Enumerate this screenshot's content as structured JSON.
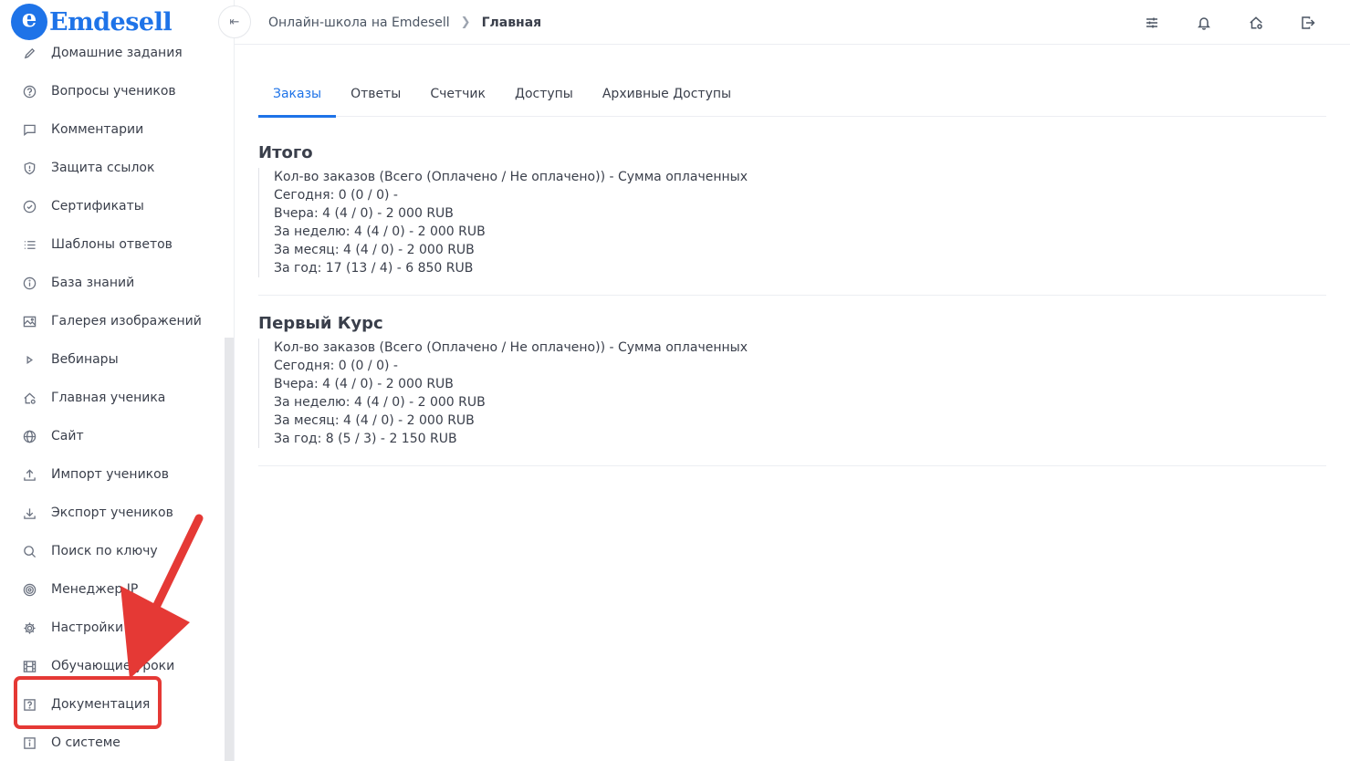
{
  "brand": {
    "logo_letter": "e",
    "name": "Emdesell"
  },
  "sidebar": {
    "items": [
      {
        "label": "Домашние задания",
        "icon": "pencil-icon"
      },
      {
        "label": "Вопросы учеников",
        "icon": "question-circle-icon"
      },
      {
        "label": "Комментарии",
        "icon": "comment-icon"
      },
      {
        "label": "Защита ссылок",
        "icon": "shield-icon"
      },
      {
        "label": "Сертификаты",
        "icon": "check-circle-icon"
      },
      {
        "label": "Шаблоны ответов",
        "icon": "list-icon"
      },
      {
        "label": "База знаний",
        "icon": "info-circle-icon"
      },
      {
        "label": "Галерея изображений",
        "icon": "image-icon"
      },
      {
        "label": "Вебинары",
        "icon": "play-icon"
      },
      {
        "label": "Главная ученика",
        "icon": "home-gear-icon"
      },
      {
        "label": "Сайт",
        "icon": "globe-icon"
      },
      {
        "label": "Импорт учеников",
        "icon": "upload-icon"
      },
      {
        "label": "Экспорт учеников",
        "icon": "download-icon"
      },
      {
        "label": "Поиск по ключу",
        "icon": "search-icon"
      },
      {
        "label": "Менеджер IP",
        "icon": "target-icon"
      },
      {
        "label": "Настройки",
        "icon": "gear-icon"
      },
      {
        "label": "Обучающие уроки",
        "icon": "film-icon"
      },
      {
        "label": "Документация",
        "icon": "help-square-icon"
      },
      {
        "label": "О системе",
        "icon": "info-square-icon"
      }
    ]
  },
  "header": {
    "breadcrumb": [
      "Онлайн-школа на Emdesell",
      "Главная"
    ],
    "actions": [
      "sliders-icon",
      "bell-icon",
      "home-settings-icon",
      "logout-icon"
    ]
  },
  "tabs": [
    {
      "label": "Заказы",
      "active": true
    },
    {
      "label": "Ответы",
      "active": false
    },
    {
      "label": "Счетчик",
      "active": false
    },
    {
      "label": "Доступы",
      "active": false
    },
    {
      "label": "Архивные Доступы",
      "active": false
    }
  ],
  "sections": [
    {
      "title": "Итого",
      "rows": [
        "Кол-во заказов (Всего (Оплачено / Не оплачено)) - Сумма оплаченных",
        "Сегодня: 0 (0 / 0) -",
        "Вчера: 4 (4 / 0) - 2 000 RUB",
        "За неделю: 4 (4 / 0) - 2 000 RUB",
        "За месяц: 4 (4 / 0) - 2 000 RUB",
        "За год: 17 (13 / 4) - 6 850 RUB"
      ]
    },
    {
      "title": "Первый Курс",
      "rows": [
        "Кол-во заказов (Всего (Оплачено / Не оплачено)) - Сумма оплаченных",
        "Сегодня: 0 (0 / 0) -",
        "Вчера: 4 (4 / 0) - 2 000 RUB",
        "За неделю: 4 (4 / 0) - 2 000 RUB",
        "За месяц: 4 (4 / 0) - 2 000 RUB",
        "За год: 8 (5 / 3) - 2 150 RUB"
      ]
    }
  ],
  "colors": {
    "accent": "#1e73e8",
    "annotation": "#e53935"
  }
}
